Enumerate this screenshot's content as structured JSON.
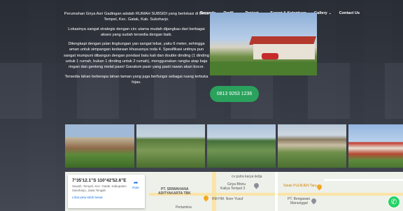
{
  "nav": {
    "items": [
      {
        "label": "Beranda",
        "dropdown": false
      },
      {
        "label": "Profil",
        "dropdown": true
      },
      {
        "label": "Project",
        "dropdown": true
      },
      {
        "label": "Syarat & Ketentuan",
        "dropdown": false
      },
      {
        "label": "Gallery",
        "dropdown": true
      },
      {
        "label": "Contact Us",
        "dropdown": false
      }
    ],
    "chevron": "⌄"
  },
  "intro": {
    "p1": "Perumahan Griya Asri Gadingan adalah RUMAH SUBSIDI yang berlokasi di Desa Tempel, Kec. Gatak, Kab. Sukoharjo.",
    "p2": "Lokasinya sangat strategis dengan circ utama mudah dijangkau dari berbagai akses yang sudah tersedia dengan baik.",
    "p3": "Dilengkapi dengan jalan lingkungan yan sangat lebar, yaitu 6 meter, sehingga aman untuk simpangan kedaraan khususnya roda 4. Spesifikasi unitnya pun sangat mumpuni dibangun dengan pondasi batu kali dan double dinding (1 dinding untuk 1 rumah, bukan 1 dinding untuk 2 rumah), menggunakan rangka atap baja ringan dan genteng metal pasir/ Gavalum pasir yang pasti rawan akan bocor.",
    "p4": "Tersedia lahan beberapa lahan taman yang juga berfungsi sebagai ruang terbuka hijau."
  },
  "phone_button": {
    "label": "0813 9263 1236",
    "color": "#2aa15c"
  },
  "map": {
    "coordinates": "7°35'12.1\"S 110°42'52.6\"E",
    "address": "Sawah, Tempel, Kec. Gatak, Kabupaten Sukoharjo, Jawa Tengah",
    "route_label": "Rute",
    "link_label": "Lihat peta lebih besar",
    "places": {
      "cv_putra": "cv putra karya ketja",
      "griya_bhinu": "Griya Bhinu",
      "kaliya_tempel": "Kaliya Tempel 3",
      "pt_sriwahana": "PT. SRIWAHANA",
      "aditya": "ADITYAKARTA TBK",
      "rm_hm": "RM HM. Noer Yusuf",
      "steak": "Steak PLENJEN Taru",
      "pt_bengawan": "PT. Bengawan",
      "manunggal": "Manunggal",
      "pertamina": "Pertamina"
    }
  },
  "whatsapp": {
    "icon": "whatsapp-icon",
    "color": "#25d366"
  }
}
